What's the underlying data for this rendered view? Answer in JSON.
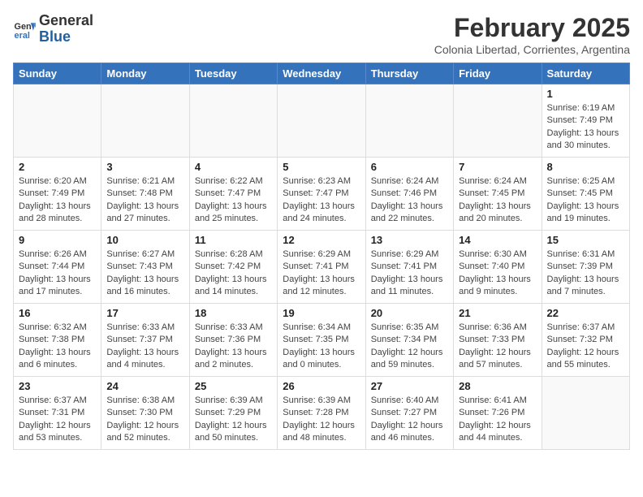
{
  "header": {
    "logo_general": "General",
    "logo_blue": "Blue",
    "month_title": "February 2025",
    "subtitle": "Colonia Libertad, Corrientes, Argentina"
  },
  "days_of_week": [
    "Sunday",
    "Monday",
    "Tuesday",
    "Wednesday",
    "Thursday",
    "Friday",
    "Saturday"
  ],
  "weeks": [
    [
      {
        "day": "",
        "info": ""
      },
      {
        "day": "",
        "info": ""
      },
      {
        "day": "",
        "info": ""
      },
      {
        "day": "",
        "info": ""
      },
      {
        "day": "",
        "info": ""
      },
      {
        "day": "",
        "info": ""
      },
      {
        "day": "1",
        "info": "Sunrise: 6:19 AM\nSunset: 7:49 PM\nDaylight: 13 hours and 30 minutes."
      }
    ],
    [
      {
        "day": "2",
        "info": "Sunrise: 6:20 AM\nSunset: 7:49 PM\nDaylight: 13 hours and 28 minutes."
      },
      {
        "day": "3",
        "info": "Sunrise: 6:21 AM\nSunset: 7:48 PM\nDaylight: 13 hours and 27 minutes."
      },
      {
        "day": "4",
        "info": "Sunrise: 6:22 AM\nSunset: 7:47 PM\nDaylight: 13 hours and 25 minutes."
      },
      {
        "day": "5",
        "info": "Sunrise: 6:23 AM\nSunset: 7:47 PM\nDaylight: 13 hours and 24 minutes."
      },
      {
        "day": "6",
        "info": "Sunrise: 6:24 AM\nSunset: 7:46 PM\nDaylight: 13 hours and 22 minutes."
      },
      {
        "day": "7",
        "info": "Sunrise: 6:24 AM\nSunset: 7:45 PM\nDaylight: 13 hours and 20 minutes."
      },
      {
        "day": "8",
        "info": "Sunrise: 6:25 AM\nSunset: 7:45 PM\nDaylight: 13 hours and 19 minutes."
      }
    ],
    [
      {
        "day": "9",
        "info": "Sunrise: 6:26 AM\nSunset: 7:44 PM\nDaylight: 13 hours and 17 minutes."
      },
      {
        "day": "10",
        "info": "Sunrise: 6:27 AM\nSunset: 7:43 PM\nDaylight: 13 hours and 16 minutes."
      },
      {
        "day": "11",
        "info": "Sunrise: 6:28 AM\nSunset: 7:42 PM\nDaylight: 13 hours and 14 minutes."
      },
      {
        "day": "12",
        "info": "Sunrise: 6:29 AM\nSunset: 7:41 PM\nDaylight: 13 hours and 12 minutes."
      },
      {
        "day": "13",
        "info": "Sunrise: 6:29 AM\nSunset: 7:41 PM\nDaylight: 13 hours and 11 minutes."
      },
      {
        "day": "14",
        "info": "Sunrise: 6:30 AM\nSunset: 7:40 PM\nDaylight: 13 hours and 9 minutes."
      },
      {
        "day": "15",
        "info": "Sunrise: 6:31 AM\nSunset: 7:39 PM\nDaylight: 13 hours and 7 minutes."
      }
    ],
    [
      {
        "day": "16",
        "info": "Sunrise: 6:32 AM\nSunset: 7:38 PM\nDaylight: 13 hours and 6 minutes."
      },
      {
        "day": "17",
        "info": "Sunrise: 6:33 AM\nSunset: 7:37 PM\nDaylight: 13 hours and 4 minutes."
      },
      {
        "day": "18",
        "info": "Sunrise: 6:33 AM\nSunset: 7:36 PM\nDaylight: 13 hours and 2 minutes."
      },
      {
        "day": "19",
        "info": "Sunrise: 6:34 AM\nSunset: 7:35 PM\nDaylight: 13 hours and 0 minutes."
      },
      {
        "day": "20",
        "info": "Sunrise: 6:35 AM\nSunset: 7:34 PM\nDaylight: 12 hours and 59 minutes."
      },
      {
        "day": "21",
        "info": "Sunrise: 6:36 AM\nSunset: 7:33 PM\nDaylight: 12 hours and 57 minutes."
      },
      {
        "day": "22",
        "info": "Sunrise: 6:37 AM\nSunset: 7:32 PM\nDaylight: 12 hours and 55 minutes."
      }
    ],
    [
      {
        "day": "23",
        "info": "Sunrise: 6:37 AM\nSunset: 7:31 PM\nDaylight: 12 hours and 53 minutes."
      },
      {
        "day": "24",
        "info": "Sunrise: 6:38 AM\nSunset: 7:30 PM\nDaylight: 12 hours and 52 minutes."
      },
      {
        "day": "25",
        "info": "Sunrise: 6:39 AM\nSunset: 7:29 PM\nDaylight: 12 hours and 50 minutes."
      },
      {
        "day": "26",
        "info": "Sunrise: 6:39 AM\nSunset: 7:28 PM\nDaylight: 12 hours and 48 minutes."
      },
      {
        "day": "27",
        "info": "Sunrise: 6:40 AM\nSunset: 7:27 PM\nDaylight: 12 hours and 46 minutes."
      },
      {
        "day": "28",
        "info": "Sunrise: 6:41 AM\nSunset: 7:26 PM\nDaylight: 12 hours and 44 minutes."
      },
      {
        "day": "",
        "info": ""
      }
    ]
  ]
}
